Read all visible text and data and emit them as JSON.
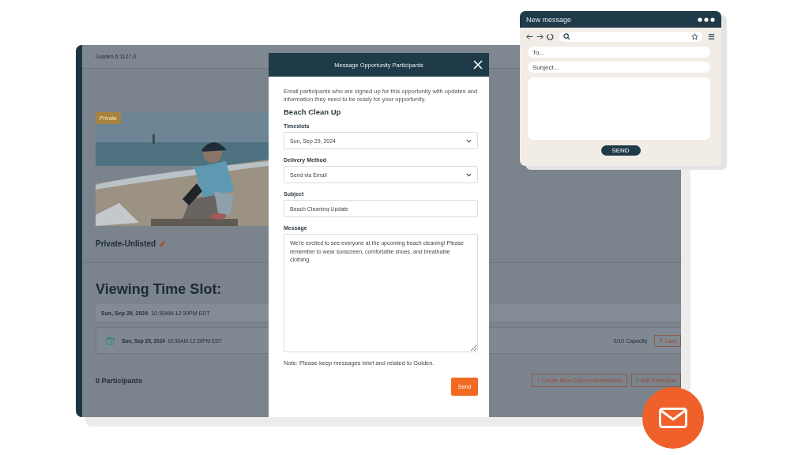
{
  "app": {
    "version": "Golden 6.1127.0",
    "photo": {
      "kind": "picture",
      "badge": "Private"
    },
    "visibility": "Private-Unlisted",
    "heading": "Viewing Time Slot:",
    "slot_summary": {
      "date": "Sun, Sep 29, 2024",
      "time": "10:30AM-12:30PM EDT"
    },
    "slot": {
      "date": "Sun, Sep 29, 2024",
      "time": "10:30AM-12:30PM EDT",
      "capacity": "0/10 Capacity",
      "action": "Laun"
    },
    "participants": "0 Participants",
    "buttons": [
      "+ Create New Custom Reservation",
      "+ Add Participan"
    ]
  },
  "modal": {
    "title": "Message Opportunity Participants",
    "intro": "Email participants who are signed up for this opportunity with updates and information they need to be ready for your opportunity.",
    "opportunity": "Beach Clean Up",
    "fields": [
      {
        "label": "Timeslots",
        "kind": "select",
        "value": "Sun, Sep 29, 2024"
      },
      {
        "label": "Delivery Method",
        "kind": "select",
        "value": "Send via Email"
      },
      {
        "label": "Subject",
        "kind": "text",
        "value": "Beach Cleaning Update"
      },
      {
        "label": "Message",
        "kind": "textarea",
        "value": "We're excited to see everyone at the upcoming beach cleaning! Please remember to wear sunscreen, comfortable shoes, and breathable clothing."
      }
    ],
    "note": "Note: Please keep messages brief and related to Golden.",
    "send": "Send"
  },
  "mail_widget": {
    "title": "New message",
    "to_placeholder": "To...",
    "subject_placeholder": "Subject...",
    "send": "SEND"
  }
}
